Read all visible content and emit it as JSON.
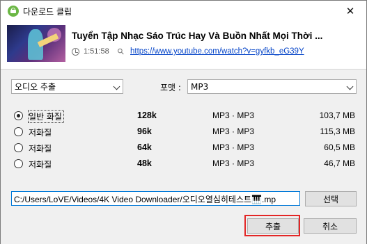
{
  "window": {
    "title": "다운로드 클립",
    "close_symbol": "✕"
  },
  "video": {
    "title": "Tuyển Tập Nhạc Sáo Trúc Hay Và Buồn Nhất Mọi Thời ...",
    "duration": "1:51:58",
    "url": "https://www.youtube.com/watch?v=gyfkb_eG39Y"
  },
  "options": {
    "mode_selected": "오디오 추출",
    "format_label": "포맷 :",
    "format_selected": "MP3"
  },
  "qualities": [
    {
      "label": "일반 화질",
      "bitrate": "128k",
      "format": "MP3 · MP3",
      "size": "103,7 MB",
      "selected": true
    },
    {
      "label": "저화질",
      "bitrate": "96k",
      "format": "MP3 · MP3",
      "size": "115,3 MB",
      "selected": false
    },
    {
      "label": "저화질",
      "bitrate": "64k",
      "format": "MP3 · MP3",
      "size": "60,5 MB",
      "selected": false
    },
    {
      "label": "저화질",
      "bitrate": "48k",
      "format": "MP3 · MP3",
      "size": "46,7 MB",
      "selected": false
    }
  ],
  "output": {
    "path": "C:/Users/LoVE/Videos/4K Video Downloader/오디오열심히테스트🎹.mp",
    "browse_label": "선택"
  },
  "actions": {
    "extract_label": "추출",
    "cancel_label": "취소"
  },
  "colors": {
    "accent": "#0078d7",
    "highlight_ring": "#e32626",
    "link": "#0645c8",
    "app_icon": "#6bb745"
  }
}
